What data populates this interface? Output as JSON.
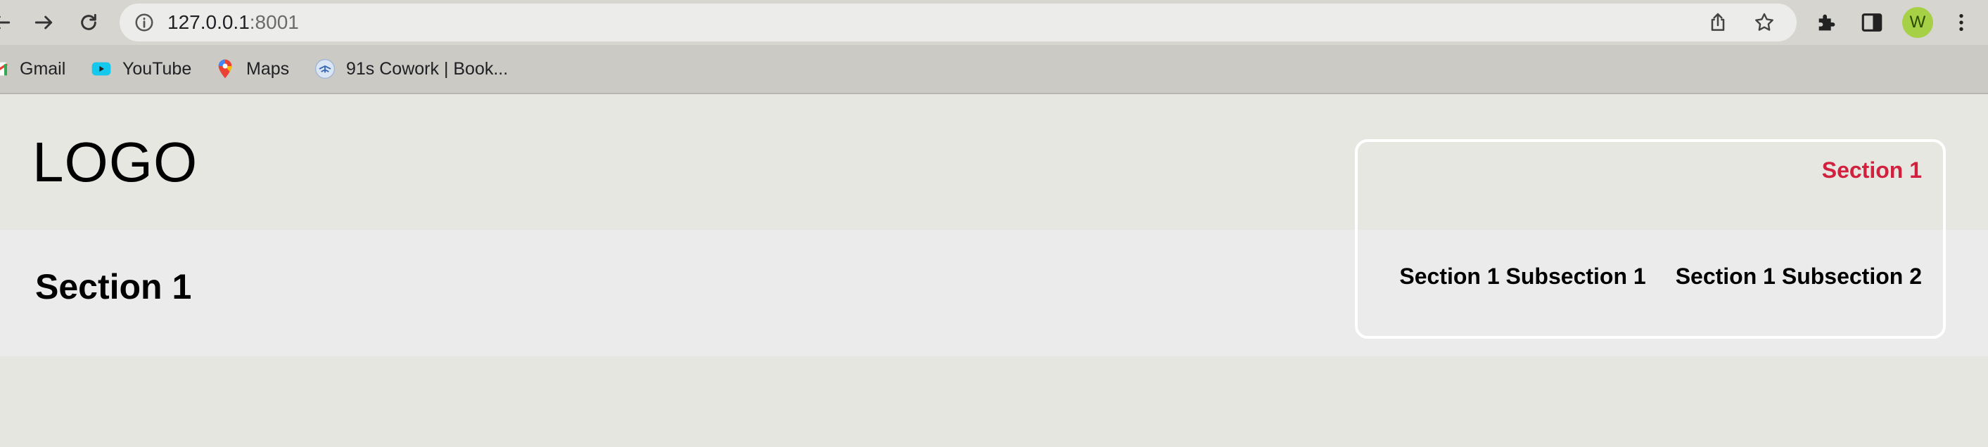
{
  "browser": {
    "url_host": "127.0.0.1",
    "url_port": ":8001",
    "profile_initial": "W",
    "icons": [
      "back-icon",
      "forward-icon",
      "reload-icon",
      "info-icon",
      "share-icon",
      "star-icon",
      "puzzle-icon",
      "sidepanel-icon",
      "kebab-menu-icon"
    ],
    "colors": {
      "toolbar": "#d6d5d0",
      "omnibox": "#ececea",
      "bookmarks_bar": "#cbcac5",
      "avatar": "#a6d045"
    }
  },
  "bookmarks": [
    {
      "label": "Gmail",
      "icon": "gmail-icon"
    },
    {
      "label": "YouTube",
      "icon": "youtube-icon"
    },
    {
      "label": "Maps",
      "icon": "maps-icon"
    },
    {
      "label": "91s Cowork | Book...",
      "icon": "cowork-icon"
    }
  ],
  "page": {
    "logo": "LOGO",
    "section_heading": "Section 1",
    "nav": {
      "active": "Section 1",
      "subsections": [
        "Section 1 Subsection 1",
        "Section 1 Subsection 2"
      ]
    },
    "colors": {
      "active_link": "#d1213e",
      "background": "#e6e6e1",
      "band": "#ebebeb",
      "panel_border": "#ffffff"
    }
  }
}
